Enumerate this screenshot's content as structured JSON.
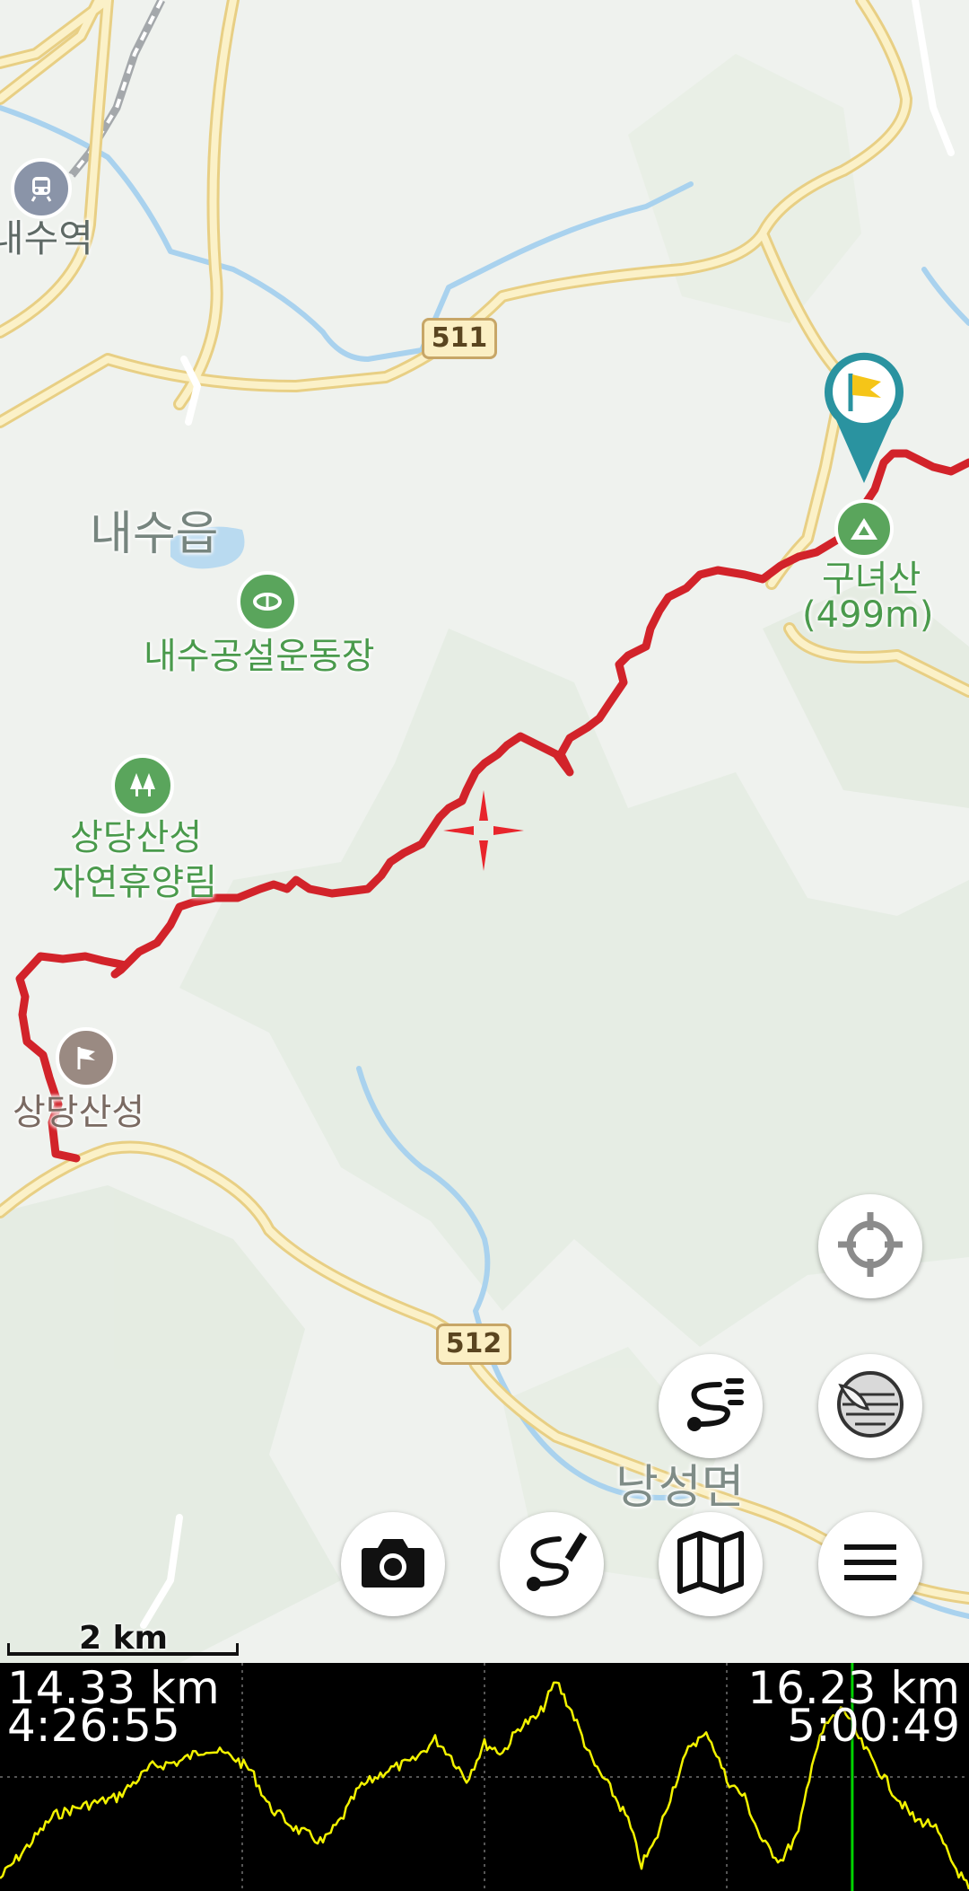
{
  "map": {
    "place_labels": {
      "station": "내수역",
      "town_naesu": "내수읍",
      "stadium": "내수공설운동장",
      "forest_1": "상당산성",
      "forest_2": "자연휴양림",
      "fortress": "상당산성",
      "town_nangseong": "낭성면",
      "peak_name": "구녀산",
      "peak_elev": "(499m)"
    },
    "road_shields": {
      "north": "511",
      "south": "512"
    },
    "scale": "2 km"
  },
  "controls": {
    "locate": "crosshair-icon",
    "layers": "layers-icon",
    "route_list": "route-list-icon",
    "camera": "camera-icon",
    "draw_route": "draw-route-icon",
    "map": "map-icon",
    "menu": "menu-icon"
  },
  "profile": {
    "left_distance": "14.33 km",
    "left_time": "4:26:55",
    "right_distance": "16.23 km",
    "right_time": "5:00:49",
    "cursor_fraction": 0.88
  },
  "colors": {
    "track": "#d2232a",
    "flag_pin": "#2a93a0",
    "flag": "#f5c518",
    "profile_line": "#f2f200",
    "profile_cursor": "#00d400"
  }
}
